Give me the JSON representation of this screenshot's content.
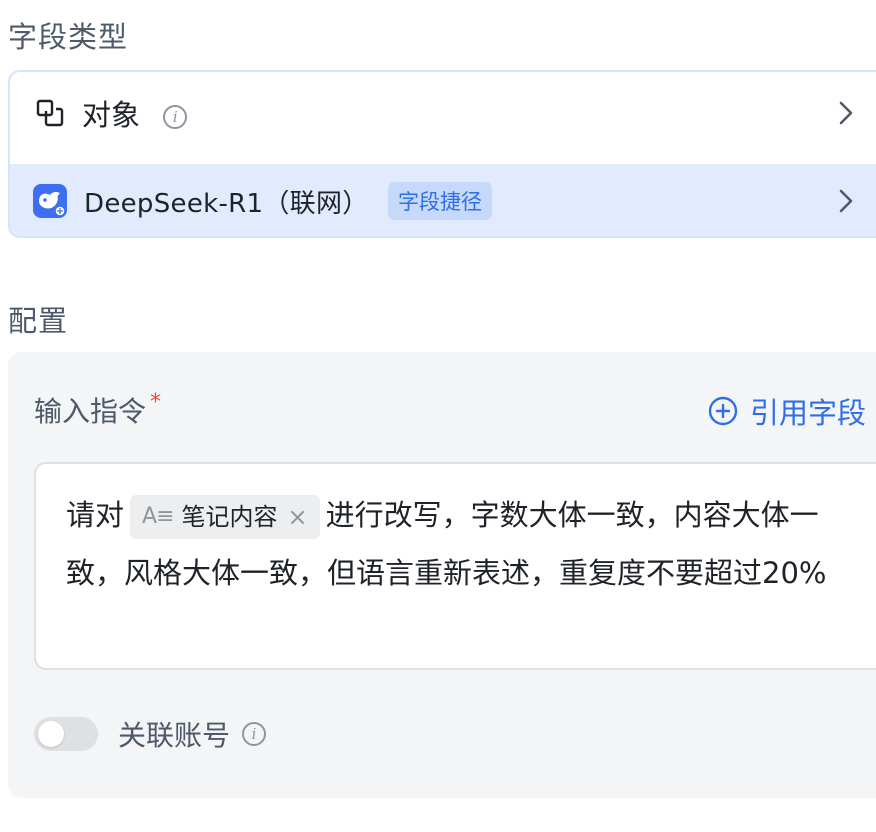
{
  "field_type": {
    "section_title": "字段类型",
    "object_option": {
      "label": "对象",
      "icon": "object-link-icon"
    },
    "model_option": {
      "label": "DeepSeek-R1（联网）",
      "icon": "deepseek-whale-icon",
      "tag": "字段捷径"
    }
  },
  "config": {
    "section_title": "配置",
    "input_instruction": {
      "label": "输入指令",
      "required_mark": "*",
      "reference_link": "引用字段",
      "prompt_before": "请对",
      "chip": {
        "icon_text": "A≡",
        "label": "笔记内容",
        "close": "×"
      },
      "prompt_after": "进行改写，字数大体一致，内容大体一致，风格大体一致，但语言重新表述，重复度不要超过20%"
    },
    "linked_account": {
      "label": "关联账号",
      "enabled": false
    }
  },
  "colors": {
    "accent": "#2e6ee6",
    "selected_row_bg": "#e1ebfd",
    "tag_bg": "#c6d9fb",
    "required": "#f54a45",
    "panel_bg": "#f4f5f6"
  }
}
